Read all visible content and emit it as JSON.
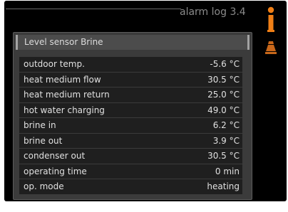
{
  "header": {
    "title": "alarm log 3.4"
  },
  "icons": {
    "status_indicator": "thermometer-icon",
    "alarm": "warning-icon",
    "accent_color": "#f07f16"
  },
  "panel": {
    "title": "Level sensor Brine",
    "rows": [
      {
        "label": "outdoor temp.",
        "value": "-5.6",
        "unit": "°C"
      },
      {
        "label": "heat medium flow",
        "value": "30.5",
        "unit": "°C"
      },
      {
        "label": "heat medium return",
        "value": "25.0",
        "unit": "°C"
      },
      {
        "label": "hot water charging",
        "value": "49.0",
        "unit": "°C"
      },
      {
        "label": "brine in",
        "value": "6.2",
        "unit": "°C"
      },
      {
        "label": "brine out",
        "value": "3.9",
        "unit": "°C"
      },
      {
        "label": "condenser out",
        "value": "30.5",
        "unit": "°C"
      },
      {
        "label": "operating time",
        "value": "0",
        "unit": "min"
      },
      {
        "label": "op. mode",
        "value": "heating",
        "unit": ""
      }
    ]
  }
}
